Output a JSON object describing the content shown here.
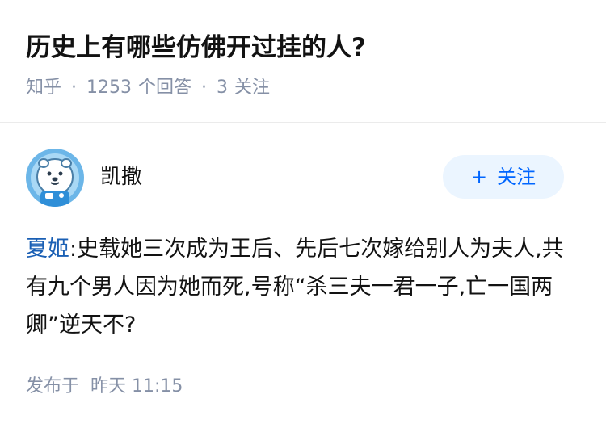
{
  "question": {
    "title": "历史上有哪些仿佛开过挂的人?",
    "source": "知乎",
    "separator": "·",
    "answer_count": "1253",
    "answer_unit": "个回答",
    "follower_count": "3",
    "follower_unit": "关注"
  },
  "author": {
    "name": "凯撒",
    "avatar_icon": "bear-astronaut-avatar-icon"
  },
  "follow_button": {
    "icon": "+",
    "label": "关注"
  },
  "answer": {
    "highlight": "夏姬",
    "text": ":史载她三次成为王后、先后七次嫁给别人为夫人,共有九个男人因为她而死,号称“杀三夫一君一子,亡一国两卿”逆天不?"
  },
  "publish": {
    "label": "发布于",
    "time": "昨天 11:15"
  },
  "colors": {
    "link": "#1a5fb4",
    "meta": "#8590a6",
    "button_bg": "#ebf5ff",
    "button_text": "#0066ff"
  }
}
